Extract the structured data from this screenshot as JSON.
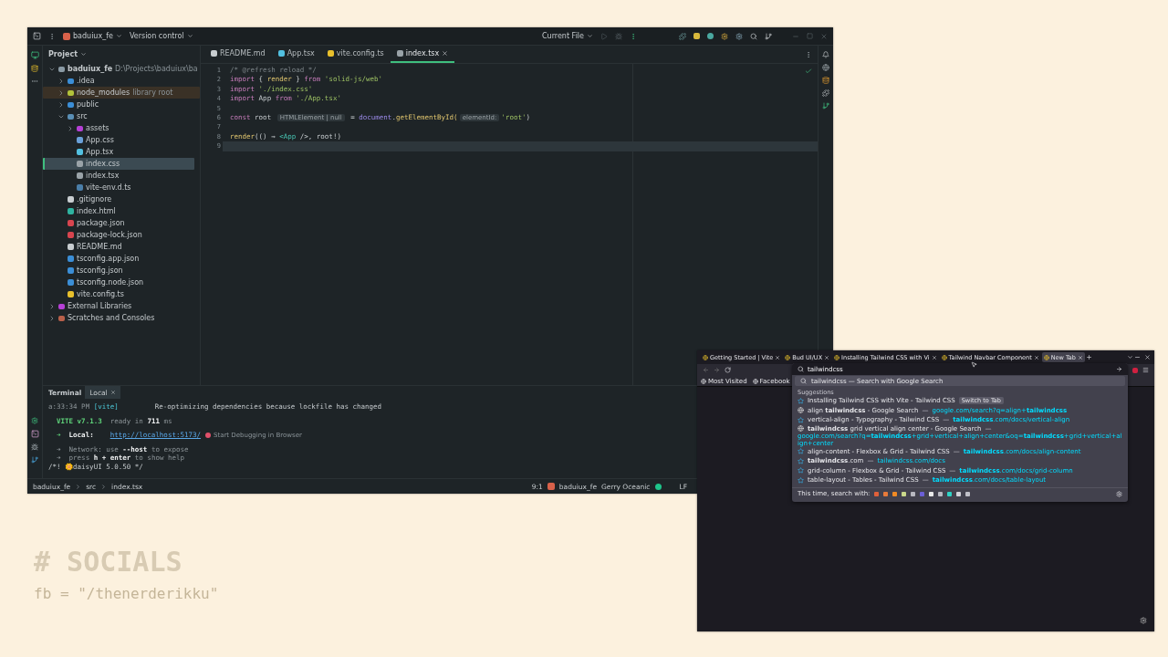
{
  "ide": {
    "title_bar": {
      "project": "baduiux_fe",
      "vcs": "Version control",
      "run_config": "Current File"
    },
    "project_panel": {
      "title": "Project",
      "tree": [
        {
          "label": "baduiux_fe",
          "hint": "D:\\Projects\\baduiux\\ba",
          "kind": "project",
          "expanded": true,
          "selected": false,
          "children": [
            {
              "label": ".idea",
              "kind": "folder",
              "expanded": false,
              "selected": false
            },
            {
              "label": "node_modules",
              "hint": "library root",
              "kind": "modules",
              "excluded": true,
              "expanded": false,
              "selected": false
            },
            {
              "label": "public",
              "kind": "folder",
              "expanded": false,
              "selected": false
            },
            {
              "label": "src",
              "kind": "source",
              "expanded": true,
              "selected": false,
              "children": [
                {
                  "label": "assets",
                  "kind": "assets",
                  "expanded": false,
                  "selected": false
                },
                {
                  "label": "App.css",
                  "kind": "css",
                  "selected": false
                },
                {
                  "label": "App.tsx",
                  "kind": "react",
                  "selected": false
                },
                {
                  "label": "index.css",
                  "kind": "style",
                  "selected": true
                },
                {
                  "label": "index.tsx",
                  "kind": "style",
                  "selected": false
                },
                {
                  "label": "vite-env.d.ts",
                  "kind": "dts",
                  "selected": false
                }
              ]
            },
            {
              "label": ".gitignore",
              "kind": "git",
              "selected": false
            },
            {
              "label": "index.html",
              "kind": "html",
              "selected": false
            },
            {
              "label": "package.json",
              "kind": "json",
              "selected": false
            },
            {
              "label": "package-lock.json",
              "kind": "lock",
              "selected": false
            },
            {
              "label": "README.md",
              "kind": "markdown",
              "selected": false
            },
            {
              "label": "tsconfig.app.json",
              "kind": "config",
              "selected": false
            },
            {
              "label": "tsconfig.json",
              "kind": "config",
              "selected": false
            },
            {
              "label": "tsconfig.node.json",
              "kind": "config",
              "selected": false
            },
            {
              "label": "vite.config.ts",
              "kind": "vite",
              "selected": false
            }
          ]
        },
        {
          "label": "External Libraries",
          "kind": "library",
          "expanded": false,
          "selected": false
        },
        {
          "label": "Scratches and Consoles",
          "kind": "scratch",
          "expanded": false,
          "selected": false
        }
      ]
    },
    "editor_tabs": [
      {
        "label": "README.md",
        "kind": "markdown",
        "selected": false
      },
      {
        "label": "App.tsx",
        "kind": "react",
        "selected": false
      },
      {
        "label": "vite.config.ts",
        "kind": "vite",
        "selected": false
      },
      {
        "label": "index.tsx",
        "kind": "style",
        "selected": true
      }
    ],
    "code": [
      {
        "number": "1",
        "tokens": [
          {
            "kind": "comment",
            "text": "/* @refresh reload */"
          }
        ]
      },
      {
        "number": "2",
        "tokens": [
          {
            "kind": "keyword",
            "text": "import"
          },
          {
            "kind": "plain",
            "text": " { "
          },
          {
            "kind": "function",
            "text": "render"
          },
          {
            "kind": "plain",
            "text": " } "
          },
          {
            "kind": "keyword",
            "text": "from "
          },
          {
            "kind": "string",
            "text": "'solid-js/web'"
          }
        ]
      },
      {
        "number": "3",
        "tokens": [
          {
            "kind": "keyword",
            "text": "import "
          },
          {
            "kind": "string",
            "text": "'./index.css'"
          }
        ]
      },
      {
        "number": "4",
        "tokens": [
          {
            "kind": "keyword",
            "text": "import"
          },
          {
            "kind": "plain",
            "text": " App "
          },
          {
            "kind": "keyword",
            "text": "from "
          },
          {
            "kind": "string",
            "text": "'./App.tsx'"
          }
        ]
      },
      {
        "number": "5"
      },
      {
        "number": "6",
        "tokens": [
          {
            "kind": "keyword",
            "text": "const"
          },
          {
            "kind": "plain",
            "text": " root "
          },
          {
            "kind": "hint",
            "text": "HTMLElement | null"
          },
          {
            "kind": "plain",
            "text": " = "
          },
          {
            "kind": "object",
            "text": "document"
          },
          {
            "kind": "plain",
            "text": "."
          },
          {
            "kind": "function",
            "text": "getElementById("
          },
          {
            "kind": "hint",
            "text": "elementId:"
          },
          {
            "kind": "string",
            "text": "'root'"
          },
          {
            "kind": "plain",
            "text": ")"
          }
        ]
      },
      {
        "number": "7"
      },
      {
        "number": "8",
        "tokens": [
          {
            "kind": "function",
            "text": "render"
          },
          {
            "kind": "plain",
            "text": "(() ⇒ "
          },
          {
            "kind": "tag",
            "text": "<App"
          },
          {
            "kind": "plain",
            "text": " />, root!)"
          }
        ]
      },
      {
        "number": "9",
        "current": true
      }
    ],
    "terminal": {
      "title": "Terminal",
      "tabs": [
        {
          "label": "Local",
          "selected": true
        }
      ],
      "lines": [
        [
          {
            "kind": "dim",
            "text": "a:33:34 PM"
          },
          {
            "kind": "accent",
            "text": " [vite]"
          },
          {
            "kind": "wide",
            "text": "Re-optimizing dependencies because lockfile has changed"
          }
        ],
        [
          {
            "kind": "green",
            "text": "  VITE v7.1.3"
          },
          {
            "kind": "dim",
            "text": "  ready in "
          },
          {
            "kind": "bold",
            "text": "711"
          },
          {
            "kind": "dim",
            "text": " ms"
          }
        ],
        [
          {
            "kind": "green",
            "text": "  ➜  "
          },
          {
            "kind": "bold",
            "text": "Local:"
          },
          {
            "kind": "link",
            "text": "http://localhost:5173/"
          },
          {
            "kind": "action",
            "text": "Start Debugging in Browser"
          }
        ],
        [
          {
            "kind": "dim",
            "text": "  ➜  Network: use "
          },
          {
            "kind": "bold",
            "text": "--host"
          },
          {
            "kind": "dim",
            "text": " to expose"
          }
        ],
        [
          {
            "kind": "dim",
            "text": "  ➜  press "
          },
          {
            "kind": "bold",
            "text": "h + enter"
          },
          {
            "kind": "dim",
            "text": " to show help"
          }
        ],
        [
          {
            "kind": "plain",
            "text": "/*! 🌼daisyUI 5.0.50 */"
          }
        ]
      ]
    },
    "status_bar": {
      "breadcrumbs": [
        "baduiux_fe",
        "src",
        "index.tsx"
      ],
      "position": "9:1",
      "project": "baduiux_fe",
      "theme": "Gerry Oceanic",
      "line_ending": "LF"
    }
  },
  "browser": {
    "tabs": [
      {
        "title": "Getting Started | Vite",
        "selected": false
      },
      {
        "title": "Bud UI/UX",
        "selected": false
      },
      {
        "title": "Installing Tailwind CSS with Vi",
        "selected": false
      },
      {
        "title": "Tailwind Navbar Component",
        "selected": false
      },
      {
        "title": "New Tab",
        "selected": true
      }
    ],
    "address": {
      "value": "tailwindcss"
    },
    "bookmarks": [
      "Most Visited",
      "Facebook"
    ],
    "search_row": "tailwindcss — Search with Google Search",
    "suggestions_title": "Suggestions",
    "suggestions": [
      {
        "kind": "page",
        "title": "Installing Tailwind CSS with Vite - Tailwind CSS",
        "action": "Switch to Tab"
      },
      {
        "kind": "search",
        "title": "align **tailwindcss** - Google Search",
        "separator": "—",
        "url": "google.com/search?q=align+**tailwindcss**"
      },
      {
        "kind": "page",
        "title": "vertical-align - Typography - Tailwind CSS",
        "separator": "—",
        "url": "**tailwindcss**.com/docs/vertical-align"
      },
      {
        "kind": "search",
        "title": "**tailwindcss** grid vertical align center - Google Search",
        "separator": "—",
        "url": "google.com/search?q=**tailwindcss**+grid+vertical+align+center&oq=**tailwindcss**+grid+vertical+align+center"
      },
      {
        "kind": "page",
        "title": "align-content - Flexbox & Grid - Tailwind CSS",
        "separator": "—",
        "url": "**tailwindcss**.com/docs/align-content"
      },
      {
        "kind": "page",
        "title": "**tailwindcss**.com",
        "separator": "—",
        "url": "tailwindcss.com/docs"
      },
      {
        "kind": "page",
        "title": "grid-column - Flexbox & Grid - Tailwind CSS",
        "separator": "—",
        "url": "**tailwindcss**.com/docs/grid-column"
      },
      {
        "kind": "page",
        "title": "table-layout - Tables - Tailwind CSS",
        "separator": "—",
        "url": "**tailwindcss**.com/docs/table-layout"
      }
    ],
    "footer": "This time, search with:",
    "engines": [
      {
        "color": "#e0603a"
      },
      {
        "color": "#e87a3a"
      },
      {
        "color": "#f08a24"
      },
      {
        "color": "#c9d88a"
      },
      {
        "color": "#b8b8c0"
      },
      {
        "color": "#6b5fd6"
      },
      {
        "color": "#e8e8e8"
      },
      {
        "color": "#b8b8c0"
      },
      {
        "color": "#2ed3c6"
      },
      {
        "color": "#d0d0d8"
      },
      {
        "color": "#c0c0c8"
      }
    ]
  },
  "socials": {
    "heading": "# SOCIALS",
    "line": "fb = \"/thenerderikku\""
  }
}
